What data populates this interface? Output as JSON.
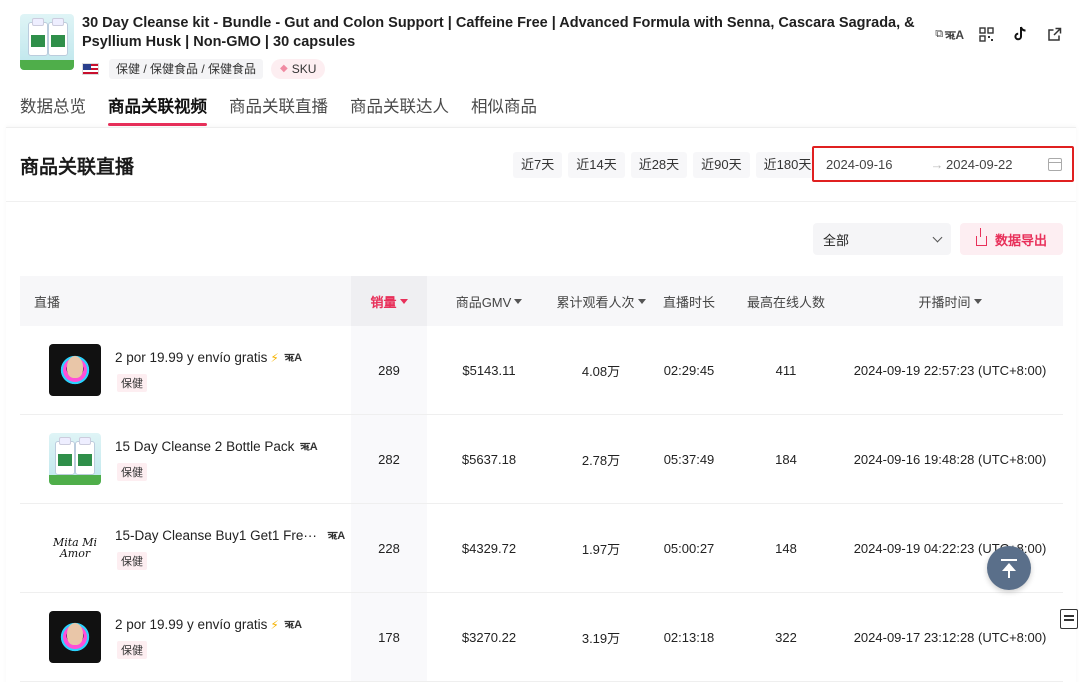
{
  "product": {
    "title": "30 Day Cleanse kit - Bundle - Gut and Colon Support | Caffeine Free | Advanced Formula with Senna, Cascara Sagrada, & Psyllium Husk | Non-GMO | 30 capsules",
    "category": "保健 / 保健食品 / 保健食品",
    "sku_label": "SKU",
    "thumb_label": "30 Day Cleanse kit"
  },
  "tabs": [
    {
      "label": "数据总览"
    },
    {
      "label": "商品关联视频"
    },
    {
      "label": "商品关联直播"
    },
    {
      "label": "商品关联达人"
    },
    {
      "label": "相似商品"
    }
  ],
  "section": {
    "title": "商品关联直播",
    "ranges": [
      "近7天",
      "近14天",
      "近28天",
      "近90天",
      "近180天"
    ],
    "date_start": "2024-09-16",
    "date_end": "2024-09-22",
    "date_sep": "→",
    "filter_value": "全部",
    "export_label": "数据导出"
  },
  "table": {
    "headers": {
      "stream": "直播",
      "sales": "销量",
      "gmv": "商品GMV",
      "views": "累计观看人次",
      "duration": "直播时长",
      "peak": "最高在线人数",
      "start_time": "开播时间"
    },
    "rows": [
      {
        "title": "2 por 19.99 y envío gratis",
        "bolt": "⚡",
        "category": "保健",
        "sales": "289",
        "gmv": "$5143.11",
        "views": "4.08万",
        "duration": "02:29:45",
        "peak": "411",
        "start_time": "2024-09-19 22:57:23 (UTC+8:00)"
      },
      {
        "title": "15 Day Cleanse 2 Bottle Pack",
        "bolt": "",
        "category": "保健",
        "sales": "282",
        "gmv": "$5637.18",
        "views": "2.78万",
        "duration": "05:37:49",
        "peak": "184",
        "start_time": "2024-09-16 19:48:28 (UTC+8:00)"
      },
      {
        "title": "15-Day Cleanse Buy1 Get1 Fre···",
        "bolt": "",
        "category": "保健",
        "sales": "228",
        "gmv": "$4329.72",
        "views": "1.97万",
        "duration": "05:00:27",
        "peak": "148",
        "start_time": "2024-09-19 04:22:23 (UTC+8:00)"
      },
      {
        "title": "2 por 19.99 y envío gratis",
        "bolt": "⚡",
        "category": "保健",
        "sales": "178",
        "gmv": "$3270.22",
        "views": "3.19万",
        "duration": "02:13:18",
        "peak": "322",
        "start_time": "2024-09-17 23:12:28 (UTC+8:00)"
      }
    ]
  },
  "logo_text": "Mita Mi Amor",
  "translate_glyph": "ऋA",
  "colors": {
    "accent": "#e8305a",
    "highlight_border": "#e02020",
    "back_top": "#5a6f8a"
  }
}
